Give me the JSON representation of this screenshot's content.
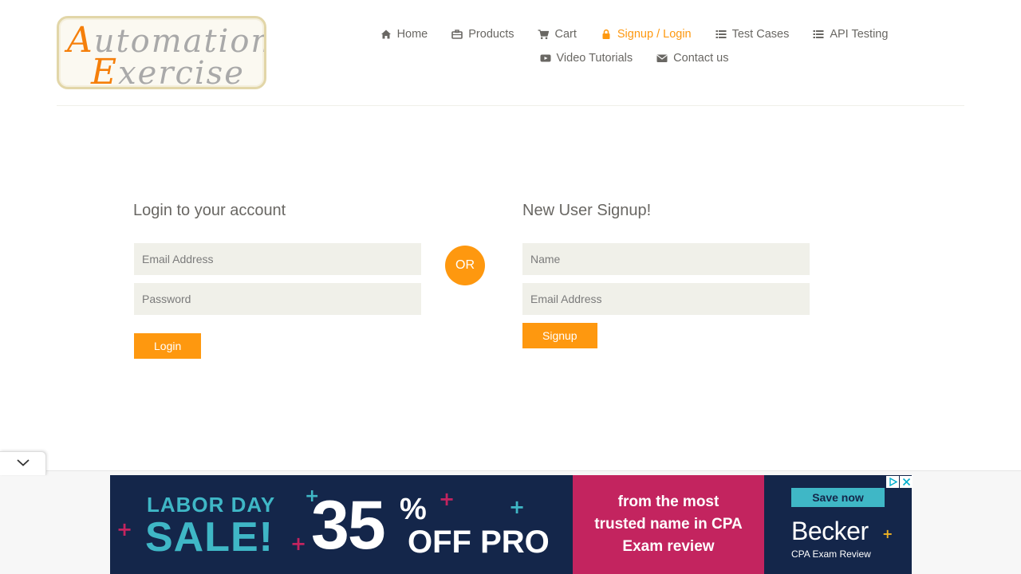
{
  "logo": {
    "line1_cap": "A",
    "line1_rest": "utomation",
    "line2_cap": "E",
    "line2_rest": "xercise"
  },
  "nav": {
    "row1": [
      {
        "icon": "home-icon",
        "label": "Home"
      },
      {
        "icon": "briefcase-icon",
        "label": "Products"
      },
      {
        "icon": "cart-icon",
        "label": "Cart"
      },
      {
        "icon": "lock-icon",
        "label": "Signup / Login",
        "active": true
      },
      {
        "icon": "list-icon",
        "label": "Test Cases"
      },
      {
        "icon": "list-icon",
        "label": "API Testing"
      }
    ],
    "row2": [
      {
        "icon": "youtube-play-icon",
        "label": "Video Tutorials"
      },
      {
        "icon": "envelope-icon",
        "label": "Contact us"
      }
    ]
  },
  "login": {
    "title": "Login to your account",
    "email_placeholder": "Email Address",
    "password_placeholder": "Password",
    "button": "Login"
  },
  "or_label": "OR",
  "signup": {
    "title": "New User Signup!",
    "name_placeholder": "Name",
    "email_placeholder": "Email Address",
    "button": "Signup"
  },
  "ad": {
    "labor": "LABOR DAY",
    "sale": "SALE!",
    "number": "35",
    "percent": "%",
    "off": "OFF PRO",
    "mid_line1": "from the most",
    "mid_line2": "trusted name in CPA",
    "mid_line3": "Exam review",
    "save": "Save now",
    "brand": "Becker",
    "brand_sub": "CPA Exam Review"
  },
  "colors": {
    "accent": "#fe980f",
    "text": "#696763",
    "field_bg": "#f0f0e9",
    "ad_navy": "#14264a",
    "ad_magenta": "#c3245f",
    "ad_teal": "#3fb7c6"
  }
}
